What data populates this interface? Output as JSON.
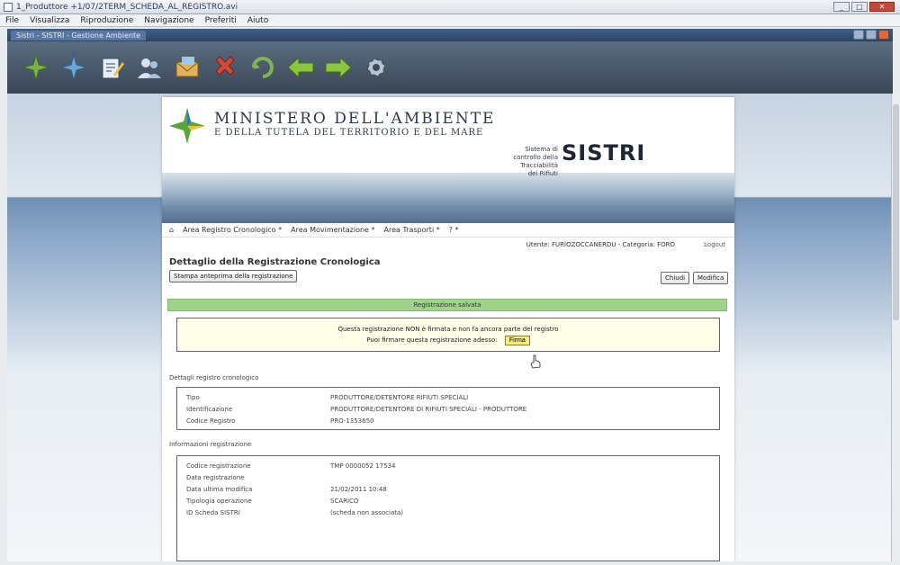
{
  "window": {
    "title": "1_Produttore +1/07/2TERM_SCHEDA_AL_REGISTRO.avi",
    "menu": [
      "File",
      "Visualizza",
      "Riproduzione",
      "Navigazione",
      "Preferiti",
      "Aiuto"
    ],
    "tab_label": "Sistri - SISTRI - Gestione Ambiente",
    "close_label": "✕"
  },
  "banner": {
    "ministry_line1": "MINISTERO DELL'AMBIENTE",
    "ministry_line2": "E DELLA TUTELA DEL TERRITORIO E DEL MARE",
    "system_caption": "Sistema di controllo della Tracciabilità dei Rifiuti",
    "brand": "SISTRI"
  },
  "nav": {
    "items": [
      "Area Registro Cronologico *",
      "Area Movimentazione *",
      "Area Trasporti *",
      "? *"
    ]
  },
  "user": {
    "label": "Utente: FURIOZOCCANERDU - Categoria: FORO",
    "logout": "Logout"
  },
  "detail": {
    "title": "Dettaglio della Registrazione Cronologica",
    "print_button": "Stampa anteprima della registrazione",
    "close_button": "Chiudi",
    "edit_button": "Modifica"
  },
  "notice": {
    "success": "Registrazione salvata",
    "line1": "Questa registrazione NON è firmata e non fa ancora parte del registro",
    "line2": "Puoi firmare questa registrazione adesso:",
    "sign_button": "Firma"
  },
  "register": {
    "heading": "Dettagli registro cronologico",
    "rows": [
      {
        "k": "Tipo",
        "v": "PRODUTTORE/DETENTORE RIFIUTI SPECIALI"
      },
      {
        "k": "Identificazione",
        "v": "PRODUTTORE/DETENTORE DI RIFIUTI SPECIALI - PRODUTTORE"
      },
      {
        "k": "Codice Registro",
        "v": "PRO-1353650"
      }
    ]
  },
  "registration": {
    "heading": "Informazioni registrazione",
    "rows": [
      {
        "k": "Codice registrazione",
        "v": "TMP 0000052 17534"
      },
      {
        "k": "Data registrazione",
        "v": ""
      },
      {
        "k": "Data ultima modifica",
        "v": "21/02/2011 10:48"
      },
      {
        "k": "Tipologia operazione",
        "v": "SCARICO"
      },
      {
        "k": "ID Scheda SISTRI",
        "v": "(scheda non associata)"
      }
    ]
  }
}
